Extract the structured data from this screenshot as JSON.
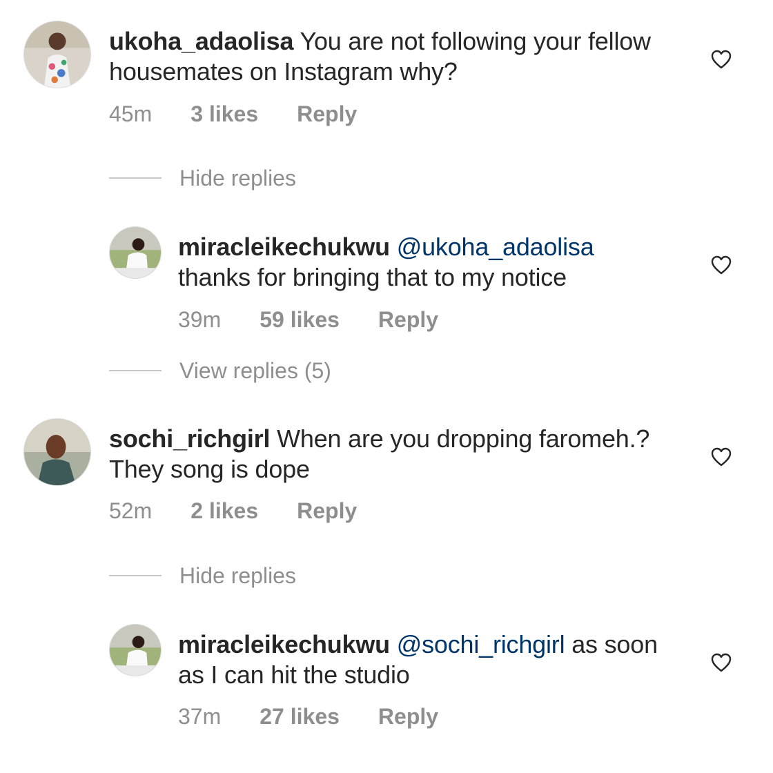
{
  "comments": [
    {
      "username": "ukoha_adaolisa",
      "text_line1": "You are not following your fellow",
      "text_line2": "housemates on Instagram why?",
      "time": "45m",
      "likes": "3 likes",
      "reply": "Reply",
      "thread_toggle": "Hide replies",
      "reply_item": {
        "username": "miracleikechukwu",
        "mention": "@ukoha_adaolisa",
        "text_line1_rest": "",
        "text_line2": "thanks for bringing that to my notice",
        "time": "39m",
        "likes": "59 likes",
        "reply": "Reply",
        "thread_toggle": "View replies (5)"
      }
    },
    {
      "username": "sochi_richgirl",
      "text_line1": "When are you dropping faromeh.?",
      "text_line2": "They song is dope",
      "time": "52m",
      "likes": "2 likes",
      "reply": "Reply",
      "thread_toggle": "Hide replies",
      "reply_item": {
        "username": "miracleikechukwu",
        "mention": "@sochi_richgirl",
        "text_line1_rest": "as soon",
        "text_line2": "as I can hit the studio",
        "time": "37m",
        "likes": "27 likes",
        "reply": "Reply"
      }
    }
  ],
  "icons": {
    "like": "heart-outline-icon"
  },
  "colors": {
    "text": "#262626",
    "meta": "#8e8e8e",
    "mention": "#003569",
    "divider": "#c7c7c7"
  }
}
